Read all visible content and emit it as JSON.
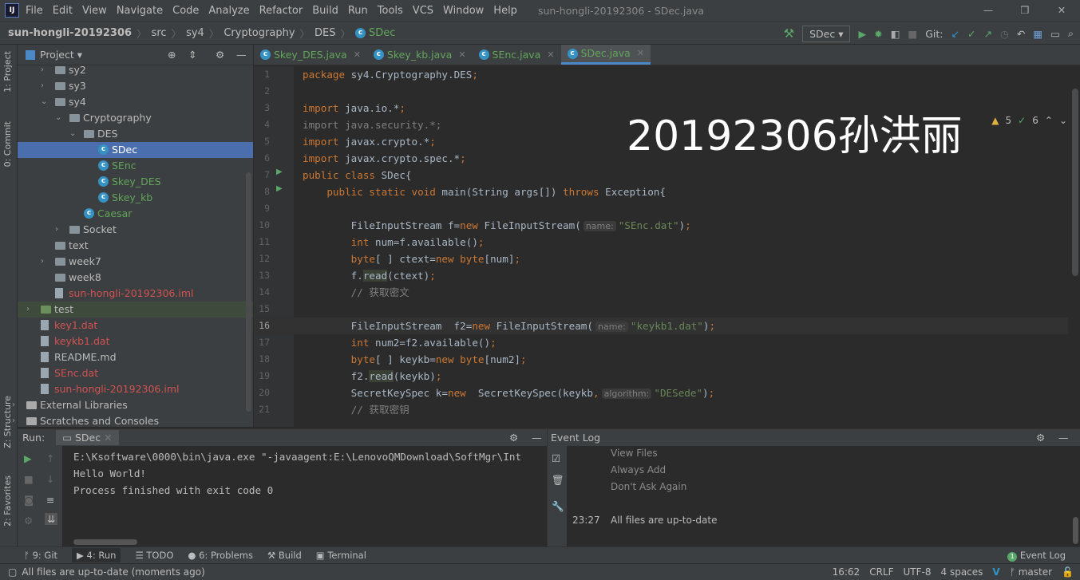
{
  "window": {
    "title": "sun-hongli-20192306 - SDec.java"
  },
  "menu": [
    "File",
    "Edit",
    "View",
    "Navigate",
    "Code",
    "Analyze",
    "Refactor",
    "Build",
    "Run",
    "Tools",
    "VCS",
    "Window",
    "Help"
  ],
  "breadcrumb": [
    "sun-hongli-20192306",
    "src",
    "sy4",
    "Cryptography",
    "DES",
    "SDec"
  ],
  "toolbar": {
    "run_config": "SDec",
    "git_label": "Git:"
  },
  "project": {
    "title": "Project",
    "tree": [
      {
        "label": "sy2",
        "color": "#bbbbbb",
        "type": "folder",
        "arrow": "right",
        "indent": 1
      },
      {
        "label": "sy3",
        "color": "#bbbbbb",
        "type": "folder",
        "arrow": "right",
        "indent": 1
      },
      {
        "label": "sy4",
        "color": "#bbbbbb",
        "type": "folder",
        "arrow": "down",
        "indent": 1
      },
      {
        "label": "Cryptography",
        "color": "#bbbbbb",
        "type": "folder",
        "arrow": "down",
        "indent": 2
      },
      {
        "label": "DES",
        "color": "#bbbbbb",
        "type": "folder",
        "arrow": "down",
        "indent": 3
      },
      {
        "label": "SDec",
        "color": "#62a55a",
        "type": "class",
        "indent": 4,
        "selected": true
      },
      {
        "label": "SEnc",
        "color": "#62a55a",
        "type": "class",
        "indent": 4
      },
      {
        "label": "Skey_DES",
        "color": "#62a55a",
        "type": "class",
        "indent": 4
      },
      {
        "label": "Skey_kb",
        "color": "#62a55a",
        "type": "class",
        "indent": 4
      },
      {
        "label": "Caesar",
        "color": "#62a55a",
        "type": "class",
        "indent": 3
      },
      {
        "label": "Socket",
        "color": "#bbbbbb",
        "type": "folder",
        "arrow": "right",
        "indent": 2
      },
      {
        "label": "text",
        "color": "#bbbbbb",
        "type": "folder",
        "indent": 1
      },
      {
        "label": "week7",
        "color": "#bbbbbb",
        "type": "folder",
        "arrow": "right",
        "indent": 1
      },
      {
        "label": "week8",
        "color": "#bbbbbb",
        "type": "folder",
        "indent": 1
      },
      {
        "label": "sun-hongli-20192306.iml",
        "color": "#d25252",
        "type": "file",
        "indent": 1
      },
      {
        "label": "test",
        "color": "#bbbbbb",
        "type": "folder",
        "arrow": "right",
        "indent": 0,
        "highlight": true
      },
      {
        "label": "key1.dat",
        "color": "#d25252",
        "type": "file",
        "indent": 0
      },
      {
        "label": "keykb1.dat",
        "color": "#d25252",
        "type": "file",
        "indent": 0
      },
      {
        "label": "README.md",
        "color": "#bbbbbb",
        "type": "file",
        "indent": 0
      },
      {
        "label": "SEnc.dat",
        "color": "#d25252",
        "type": "file",
        "indent": 0
      },
      {
        "label": "sun-hongli-20192306.iml",
        "color": "#d25252",
        "type": "file",
        "indent": 0
      },
      {
        "label": "External Libraries",
        "color": "#bbbbbb",
        "type": "lib",
        "arrow": "right",
        "indent": -1
      },
      {
        "label": "Scratches and Consoles",
        "color": "#bbbbbb",
        "type": "lib",
        "arrow": "right",
        "indent": -1
      }
    ]
  },
  "side_tabs": {
    "project": "1: Project",
    "commit": "0: Commit",
    "structure": "Z: Structure",
    "favorites": "2: Favorites"
  },
  "tabs": [
    {
      "label": "Skey_DES.java"
    },
    {
      "label": "Skey_kb.java"
    },
    {
      "label": "SEnc.java"
    },
    {
      "label": "SDec.java",
      "active": true
    }
  ],
  "inspections": {
    "warnings": "5",
    "weak_warnings": "6"
  },
  "watermark": "20192306孙洪丽",
  "code": [
    [
      [
        "kw",
        "package "
      ],
      [
        "pl",
        "sy4.Cryptography.DES"
      ],
      [
        "kw",
        ";"
      ]
    ],
    [],
    [
      [
        "kw",
        "import "
      ],
      [
        "pl",
        "java.io.*"
      ],
      [
        "kw",
        ";"
      ]
    ],
    [
      [
        "unused",
        "import java.security.*;"
      ]
    ],
    [
      [
        "kw",
        "import "
      ],
      [
        "pl",
        "javax.crypto.*"
      ],
      [
        "kw",
        ";"
      ]
    ],
    [
      [
        "kw",
        "import "
      ],
      [
        "pl",
        "javax.crypto.spec.*"
      ],
      [
        "kw",
        ";"
      ]
    ],
    [
      [
        "kw",
        "public class "
      ],
      [
        "pl",
        "SDec{"
      ]
    ],
    [
      [
        "pl",
        "    "
      ],
      [
        "kw",
        "public static void "
      ],
      [
        "pl",
        "main(String args[]) "
      ],
      [
        "kw",
        "throws "
      ],
      [
        "pl",
        "Exception{"
      ]
    ],
    [],
    [
      [
        "pl",
        "        FileInputStream f="
      ],
      [
        "kw",
        "new "
      ],
      [
        "pl",
        "FileInputStream("
      ],
      [
        "hint",
        "name:"
      ],
      [
        "str",
        "\"SEnc.dat\""
      ],
      [
        "pl",
        ")"
      ],
      [
        "kw",
        ";"
      ]
    ],
    [
      [
        "pl",
        "        "
      ],
      [
        "kw",
        "int "
      ],
      [
        "pl",
        "num=f.available()"
      ],
      [
        "kw",
        ";"
      ]
    ],
    [
      [
        "pl",
        "        "
      ],
      [
        "kw",
        "byte"
      ],
      [
        "pl",
        "[ ] ctext="
      ],
      [
        "kw",
        "new byte"
      ],
      [
        "pl",
        "[num]"
      ],
      [
        "kw",
        ";"
      ]
    ],
    [
      [
        "pl",
        "        f."
      ],
      [
        "hlread",
        "read"
      ],
      [
        "pl",
        "(ctext)"
      ],
      [
        "kw",
        ";"
      ]
    ],
    [
      [
        "cm",
        "        // 获取密文"
      ]
    ],
    [],
    [
      [
        "pl",
        "        FileInputStream  f2="
      ],
      [
        "kw",
        "new "
      ],
      [
        "pl",
        "FileInputStream("
      ],
      [
        "hint",
        "name:"
      ],
      [
        "str",
        "\"keykb1.dat\""
      ],
      [
        "pl",
        ")"
      ],
      [
        "kw",
        ";"
      ]
    ],
    [
      [
        "pl",
        "        "
      ],
      [
        "kw",
        "int "
      ],
      [
        "pl",
        "num2=f2.available()"
      ],
      [
        "kw",
        ";"
      ]
    ],
    [
      [
        "pl",
        "        "
      ],
      [
        "kw",
        "byte"
      ],
      [
        "pl",
        "[ ] keykb="
      ],
      [
        "kw",
        "new byte"
      ],
      [
        "pl",
        "[num2]"
      ],
      [
        "kw",
        ";"
      ]
    ],
    [
      [
        "pl",
        "        f2."
      ],
      [
        "hlread",
        "read"
      ],
      [
        "pl",
        "(keykb)"
      ],
      [
        "kw",
        ";"
      ]
    ],
    [
      [
        "pl",
        "        SecretKeySpec k="
      ],
      [
        "kw",
        "new  "
      ],
      [
        "pl",
        "SecretKeySpec(keykb"
      ],
      [
        "kw",
        ","
      ],
      [
        "hint",
        "algorithm:"
      ],
      [
        "str",
        "\"DESede\""
      ],
      [
        "pl",
        ")"
      ],
      [
        "kw",
        ";"
      ]
    ],
    [
      [
        "cm",
        "        // 获取密钥"
      ]
    ]
  ],
  "run": {
    "label": "Run:",
    "config": "SDec",
    "output": [
      "E:\\Ksoftware\\0000\\bin\\java.exe \"-javaagent:E:\\LenovoQMDownload\\SoftMgr\\Int",
      "Hello World!",
      "",
      "Process finished with exit code 0"
    ]
  },
  "event_log": {
    "title": "Event Log",
    "links": [
      "View Files",
      "Always Add",
      "Don't Ask Again"
    ],
    "time": "23:27",
    "message": "All files are up-to-date"
  },
  "tool_windows": [
    "9: Git",
    "4: Run",
    "TODO",
    "6: Problems",
    "Build",
    "Terminal"
  ],
  "event_log_button": "Event Log",
  "status": {
    "message": "All files are up-to-date (moments ago)",
    "position": "16:62",
    "line_sep": "CRLF",
    "encoding": "UTF-8",
    "indent": "4 spaces",
    "branch": "master"
  }
}
